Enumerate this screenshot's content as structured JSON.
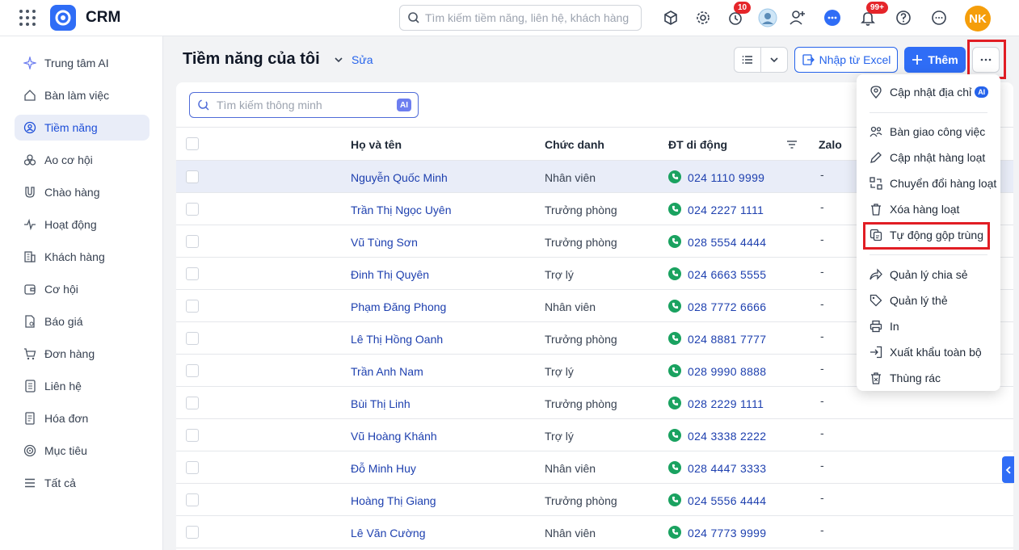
{
  "app": {
    "title": "CRM",
    "search_placeholder": "Tìm kiếm tiềm năng, liên hệ, khách hàng"
  },
  "topbar": {
    "reminder_badge": "10",
    "notification_badge": "99+",
    "avatar_initials": "NK"
  },
  "sidebar": {
    "items": [
      {
        "label": "Trung tâm AI",
        "icon": "sparkle-icon"
      },
      {
        "label": "Bàn làm việc",
        "icon": "home-icon"
      },
      {
        "label": "Tiềm năng",
        "icon": "lead-icon",
        "active": true
      },
      {
        "label": "Ao cơ hội",
        "icon": "pool-icon"
      },
      {
        "label": "Chào hàng",
        "icon": "magnet-icon"
      },
      {
        "label": "Hoạt động",
        "icon": "pulse-icon"
      },
      {
        "label": "Khách hàng",
        "icon": "building-icon"
      },
      {
        "label": "Cơ hội",
        "icon": "wallet-icon"
      },
      {
        "label": "Báo giá",
        "icon": "quote-icon"
      },
      {
        "label": "Đơn hàng",
        "icon": "cart-icon"
      },
      {
        "label": "Liên hệ",
        "icon": "contact-icon"
      },
      {
        "label": "Hóa đơn",
        "icon": "invoice-icon"
      },
      {
        "label": "Mục tiêu",
        "icon": "target-icon"
      },
      {
        "label": "Tất cả",
        "icon": "menu-icon"
      }
    ]
  },
  "header": {
    "title": "Tiềm năng của tôi",
    "edit_label": "Sửa",
    "import_label": "Nhập từ Excel",
    "add_label": "Thêm"
  },
  "table": {
    "search_placeholder": "Tìm kiếm thông minh",
    "search_ai_badge": "AI",
    "columns": {
      "name": "Họ và tên",
      "title": "Chức danh",
      "phone": "ĐT di động",
      "zalo": "Zalo"
    },
    "rows": [
      {
        "name": "Nguyễn Quốc Minh",
        "title": "Nhân viên",
        "phone": "024 1110 9999",
        "zalo": "-"
      },
      {
        "name": "Trần Thị Ngọc Uyên",
        "title": "Trưởng phòng",
        "phone": "024 2227 1111",
        "zalo": "-"
      },
      {
        "name": "Vũ Tùng Sơn",
        "title": "Trưởng phòng",
        "phone": "028 5554 4444",
        "zalo": "-"
      },
      {
        "name": "Đinh Thị Quyên",
        "title": "Trợ lý",
        "phone": "024 6663 5555",
        "zalo": "-"
      },
      {
        "name": "Phạm Đăng Phong",
        "title": "Nhân viên",
        "phone": "028 7772 6666",
        "zalo": "-"
      },
      {
        "name": "Lê Thị Hồng Oanh",
        "title": "Trưởng phòng",
        "phone": "024 8881 7777",
        "zalo": "-"
      },
      {
        "name": "Trần Anh Nam",
        "title": "Trợ lý",
        "phone": "028 9990 8888",
        "zalo": "-"
      },
      {
        "name": "Bùi Thị Linh",
        "title": "Trưởng phòng",
        "phone": "028 2229 1111",
        "zalo": "-"
      },
      {
        "name": "Vũ Hoàng Khánh",
        "title": "Trợ lý",
        "phone": "024 3338 2222",
        "zalo": "-"
      },
      {
        "name": "Đỗ Minh Huy",
        "title": "Nhân viên",
        "phone": "028 4447 3333",
        "zalo": "-"
      },
      {
        "name": "Hoàng Thị Giang",
        "title": "Trưởng phòng",
        "phone": "024 5556 4444",
        "zalo": "-"
      },
      {
        "name": "Lê Văn Cường",
        "title": "Nhân viên",
        "phone": "024 7773 9999",
        "zalo": "-"
      }
    ]
  },
  "more_menu": {
    "ai_badge": "AI",
    "items": [
      {
        "label": "Cập nhật địa chỉ",
        "icon": "location-icon"
      },
      {
        "label": "Bàn giao công việc",
        "icon": "handover-icon"
      },
      {
        "label": "Cập nhật hàng loạt",
        "icon": "pencil-icon"
      },
      {
        "label": "Chuyển đổi hàng loạt",
        "icon": "convert-icon"
      },
      {
        "label": "Xóa hàng loạt",
        "icon": "trash-icon"
      },
      {
        "label": "Tự động gộp trùng",
        "icon": "merge-icon"
      },
      {
        "label": "Quản lý chia sẻ",
        "icon": "share-icon"
      },
      {
        "label": "Quản lý thẻ",
        "icon": "tag-icon"
      },
      {
        "label": "In",
        "icon": "printer-icon"
      },
      {
        "label": "Xuất khẩu toàn bộ",
        "icon": "export-icon"
      },
      {
        "label": "Thùng rác",
        "icon": "bin-icon"
      }
    ]
  },
  "colors": {
    "primary": "#2f6df6",
    "link": "#1e40af",
    "highlight": "#e11d24",
    "selected_row": "#e9edf8",
    "phone_green": "#1aa260"
  }
}
